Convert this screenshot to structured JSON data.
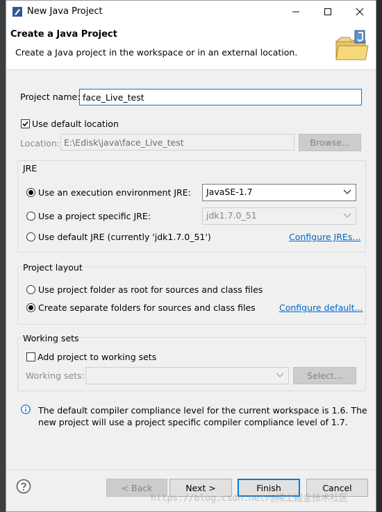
{
  "window": {
    "title": "New Java Project",
    "minimize": "—",
    "maximize": "☐",
    "close": "✕"
  },
  "header": {
    "title": "Create a Java Project",
    "description": "Create a Java project in the workspace or in an external location."
  },
  "project": {
    "name_label": "Project name:",
    "name_value": "face_Live_test"
  },
  "location": {
    "use_default_label": "Use default location",
    "use_default_checked": true,
    "location_label": "Location:",
    "location_value": "E:\\Edisk\\java\\face_Live_test",
    "browse_label": "Browse..."
  },
  "jre": {
    "group_label": "JRE",
    "option_env_label": "Use an execution environment JRE:",
    "option_env_value": "JavaSE-1.7",
    "option_specific_label": "Use a project specific JRE:",
    "option_specific_value": "jdk1.7.0_51",
    "option_default_label": "Use default JRE (currently 'jdk1.7.0_51')",
    "configure_link": "Configure JREs...",
    "selected": "env"
  },
  "layout": {
    "group_label": "Project layout",
    "option_root_label": "Use project folder as root for sources and class files",
    "option_separate_label": "Create separate folders for sources and class files",
    "configure_link": "Configure default...",
    "selected": "separate"
  },
  "working_sets": {
    "group_label": "Working sets",
    "add_label": "Add project to working sets",
    "add_checked": false,
    "sets_label": "Working sets:",
    "select_label": "Select..."
  },
  "info": {
    "text": "The default compiler compliance level for the current workspace is 1.6. The new project will use a project specific compiler compliance level of 1.7."
  },
  "buttons": {
    "back": "< Back",
    "next": "Next >",
    "finish": "Finish",
    "cancel": "Cancel"
  },
  "watermark": "https://blog.csdn.net/@稀土掘金技术社区"
}
